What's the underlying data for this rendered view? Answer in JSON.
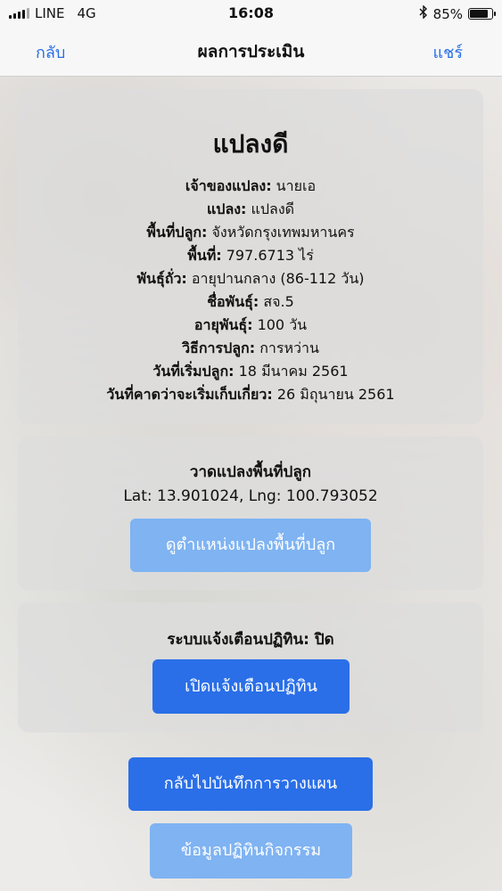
{
  "status_bar": {
    "carrier": "LINE",
    "network": "4G",
    "time": "16:08",
    "bluetooth_icon": "bluetooth-icon",
    "battery_percent": "85%",
    "battery_level": 0.85
  },
  "nav": {
    "back_label": "กลับ",
    "title": "ผลการประเมิน",
    "share_label": "แชร์"
  },
  "plot_info": {
    "title": "แปลงดี",
    "lines": [
      {
        "label": "เจ้าของแปลง:",
        "value": " นายเอ"
      },
      {
        "label": "แปลง:",
        "value": " แปลงดี"
      },
      {
        "label": "พื้นที่ปลูก:",
        "value": " จังหวัดกรุงเทพมหานคร"
      },
      {
        "label": "พื้นที่:",
        "value": " 797.6713 ไร่"
      },
      {
        "label": "พันธุ์ถั่ว:",
        "value": " อายุปานกลาง (86-112 วัน)"
      },
      {
        "label": "ชื่อพันธุ์:",
        "value": " สจ.5"
      },
      {
        "label": "อายุพันธุ์:",
        "value": " 100 วัน"
      },
      {
        "label": "วิธีการปลูก:",
        "value": " การหว่าน"
      },
      {
        "label": "วันที่เริ่มปลูก:",
        "value": " 18 มีนาคม 2561"
      },
      {
        "label": "วันที่คาดว่าจะเริ่มเก็บเกี่ยว:",
        "value": " 26 มิถุนายน 2561"
      }
    ]
  },
  "location": {
    "title": "วาดแปลงพื้นที่ปลูก",
    "coords": "Lat: 13.901024, Lng: 100.793052",
    "view_button": "ดูตำแหน่งแปลงพื้นที่ปลูก"
  },
  "calendar_alert": {
    "status_label": "ระบบแจ้งเตือนปฏิทิน:",
    "status_value": " ปิด",
    "enable_button": "เปิดแจ้งเตือนปฏิทิน"
  },
  "actions": {
    "back_to_planning": "กลับไปบันทึกการวางแผน",
    "activity_calendar": "ข้อมูลปฏิทินกิจกรรม"
  },
  "colors": {
    "accent": "#2a6fe8",
    "accent_light": "#7fb3f2"
  }
}
